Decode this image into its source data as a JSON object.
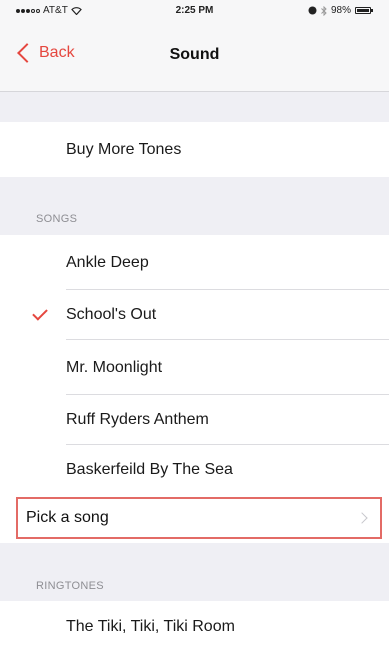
{
  "status_bar": {
    "carrier": "AT&T",
    "time": "2:25 PM",
    "battery": "98%",
    "battery_level": 0.98,
    "icons": [
      "signal-dots-icon",
      "wifi-icon",
      "lock-rotation-icon",
      "bluetooth-icon",
      "battery-icon"
    ]
  },
  "nav": {
    "back_label": "Back",
    "title": "Sound"
  },
  "store": {
    "buy_more_label": "Buy More Tones"
  },
  "songs": {
    "header": "SONGS",
    "items": [
      {
        "label": "Ankle Deep",
        "selected": false
      },
      {
        "label": "School's Out",
        "selected": true
      },
      {
        "label": "Mr. Moonlight",
        "selected": false
      },
      {
        "label": "Ruff Ryders Anthem",
        "selected": false
      },
      {
        "label": "Baskerfeild By The Sea",
        "selected": false
      }
    ],
    "pick_label": "Pick a song"
  },
  "ringtones": {
    "header": "RINGTONES",
    "items": [
      {
        "label": "The Tiki, Tiki, Tiki Room"
      }
    ]
  },
  "colors": {
    "accent": "#e5473f",
    "highlight_border": "#e36b66",
    "background": "#efeff4",
    "header_text": "#8e8e93"
  }
}
